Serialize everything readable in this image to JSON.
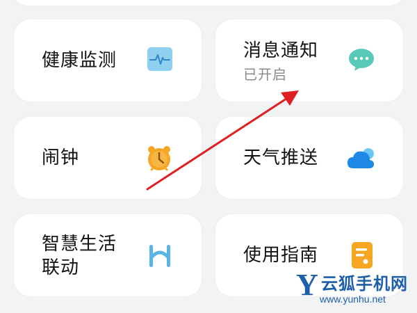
{
  "cards": {
    "health": {
      "title": "健康监测"
    },
    "notifications": {
      "title": "消息通知",
      "status": "已开启"
    },
    "alarm": {
      "title": "闹钟"
    },
    "weather": {
      "title": "天气推送"
    },
    "smart_life": {
      "title_line1": "智慧生活",
      "title_line2": "联动"
    },
    "guide": {
      "title": "使用指南"
    }
  },
  "watermark": {
    "logo_letter": "Y",
    "name": "云狐手机网",
    "url": "www.yunhu.net"
  },
  "colors": {
    "background": "#f2f3f5",
    "card": "#ffffff",
    "health_icon": "#8fd0f0",
    "notification_icon": "#58c9b9",
    "alarm_icon": "#f5a623",
    "weather_icon": "#1e88e5",
    "smart_life_icon": "#5ab4e5",
    "guide_icon": "#f5a623",
    "arrow": "#e02020",
    "watermark": "#1d5fa8"
  }
}
